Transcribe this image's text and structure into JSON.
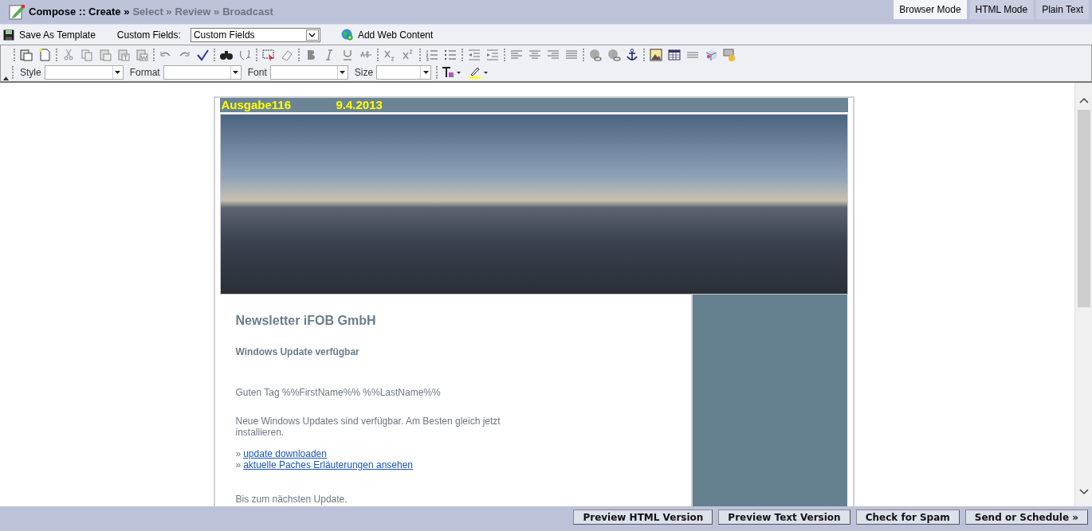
{
  "steps": [
    {
      "label": "Compose :: Create »",
      "active": true
    },
    {
      "label": "Select »",
      "active": false
    },
    {
      "label": "Review »",
      "active": false
    },
    {
      "label": "Broadcast",
      "active": false
    }
  ],
  "modes": [
    {
      "label": "Browser Mode",
      "selected": true
    },
    {
      "label": "HTML Mode",
      "selected": false
    },
    {
      "label": "Plain Text",
      "selected": false
    }
  ],
  "actions": {
    "save_template": "Save As Template",
    "custom_fields_label": "Custom Fields:",
    "custom_fields_value": "Custom Fields",
    "add_web_content": "Add Web Content"
  },
  "format_selects": [
    {
      "label": "Style"
    },
    {
      "label": "Format"
    },
    {
      "label": "Font"
    },
    {
      "label": "Size"
    }
  ],
  "email": {
    "issue": "Ausgabe116",
    "date": "9.4.2013",
    "title": "Newsletter iFOB GmbH",
    "subtitle": "Windows Update verfügbar",
    "greeting": "Guten Tag %%FirstName%% %%LastName%%",
    "body": "Neue Windows Updates sind verfügbar. Am Besten gleich jetzt installieren.",
    "links": [
      {
        "bullet": "»",
        "text": "update downloaden"
      },
      {
        "bullet": "»",
        "text": "aktuelle Paches Erläuterungen ansehen"
      }
    ],
    "closing": "Bis zum nächsten Update."
  },
  "buttons": [
    "Preview HTML Version",
    "Preview Text Version",
    "Check for Spam",
    "Send or Schedule »"
  ]
}
